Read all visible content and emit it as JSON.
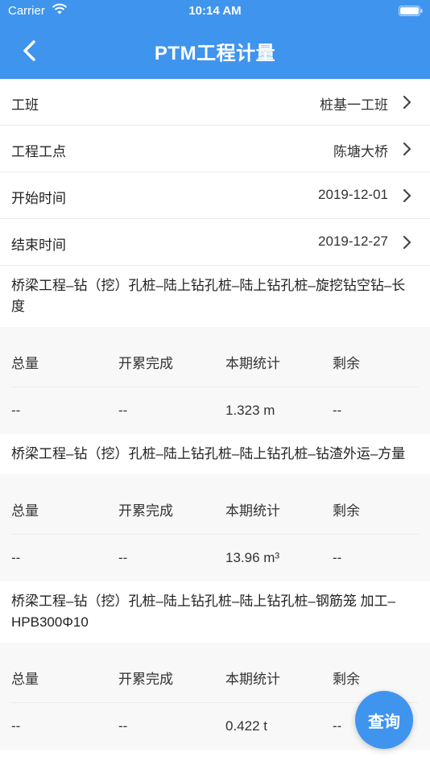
{
  "status": {
    "carrier": "Carrier",
    "time": "10:14 AM"
  },
  "header": {
    "title": "PTM工程计量"
  },
  "form": [
    {
      "label": "工班",
      "value": "桩基一工班"
    },
    {
      "label": "工程工点",
      "value": "陈塘大桥"
    },
    {
      "label": "开始时间",
      "value": "2019-12-01"
    },
    {
      "label": "结束时间",
      "value": "2019-12-27"
    }
  ],
  "columns": [
    "总量",
    "开累完成",
    "本期统计",
    "剩余"
  ],
  "sections": [
    {
      "title": "桥梁工程–钻（挖）孔桩–陆上钻孔桩–陆上钻孔桩–旋挖钻空钻–长度",
      "values": [
        "--",
        "--",
        "1.323 m",
        "--"
      ]
    },
    {
      "title": "桥梁工程–钻（挖）孔桩–陆上钻孔桩–陆上钻孔桩–钻渣外运–方量",
      "values": [
        "--",
        "--",
        "13.96 m³",
        "--"
      ]
    },
    {
      "title": "桥梁工程–钻（挖）孔桩–陆上钻孔桩–陆上钻孔桩–钢筋笼 加工–HPB300Φ10",
      "values": [
        "--",
        "--",
        "0.422 t",
        "--"
      ]
    }
  ],
  "fab": {
    "label": "查询"
  },
  "colors": {
    "primary": "#3f94ee"
  }
}
